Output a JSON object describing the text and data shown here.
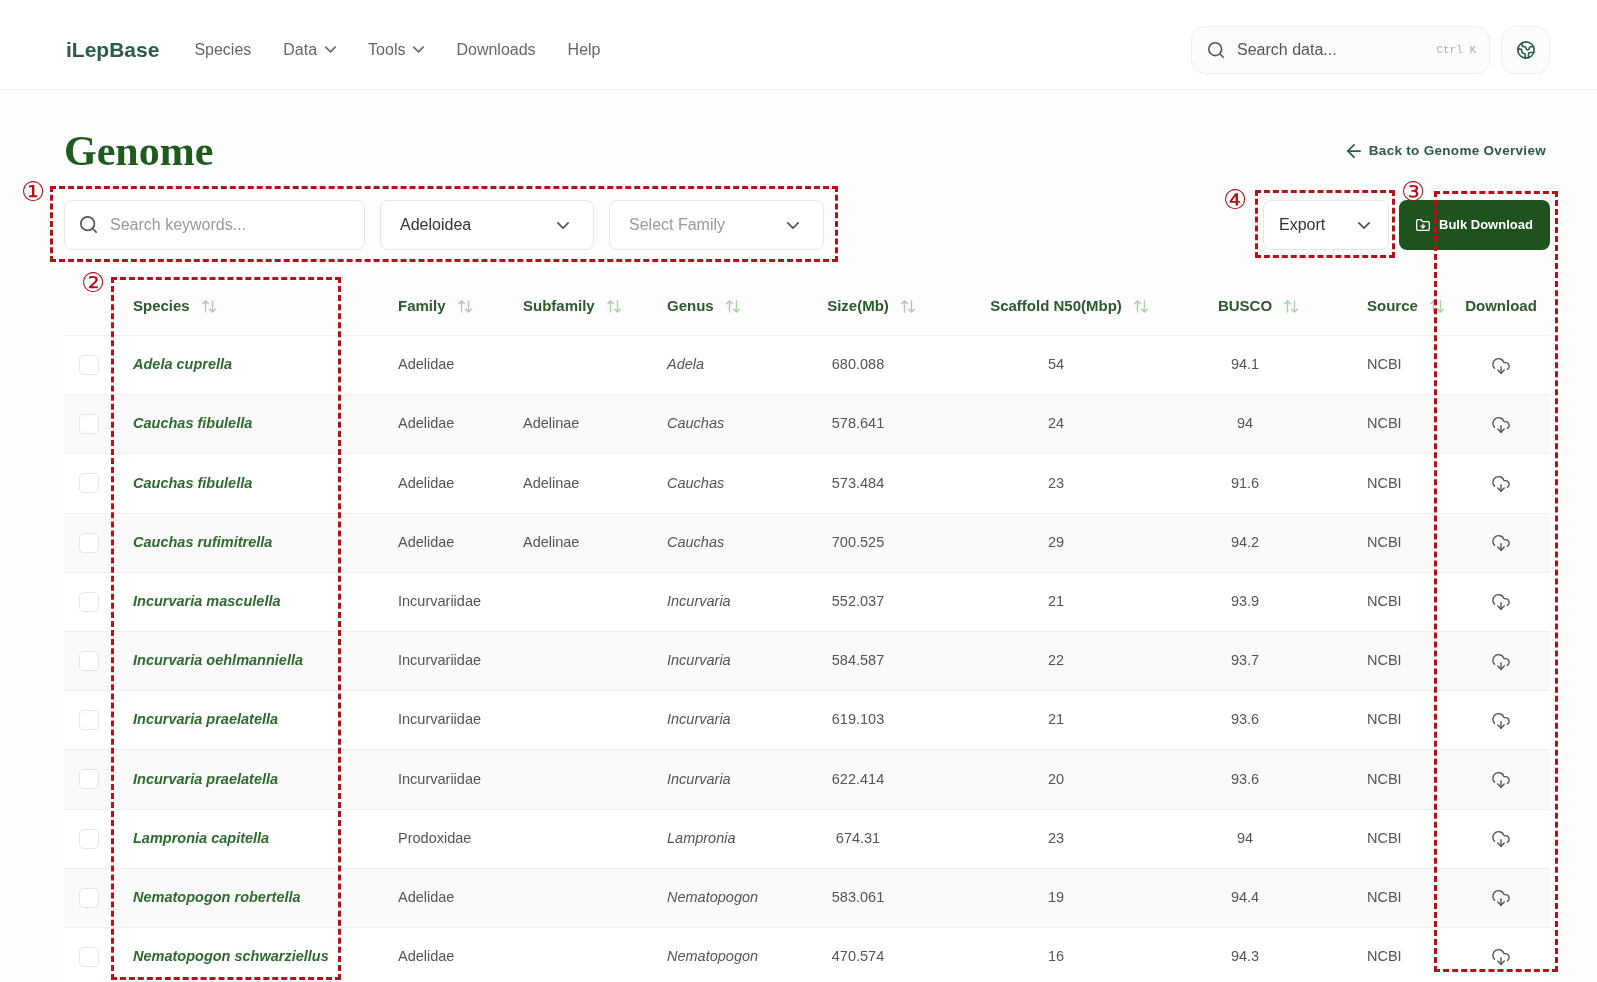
{
  "header": {
    "logo": "iLepBase",
    "nav": [
      {
        "label": "Species",
        "menu": false
      },
      {
        "label": "Data",
        "menu": true
      },
      {
        "label": "Tools",
        "menu": true
      },
      {
        "label": "Downloads",
        "menu": false
      },
      {
        "label": "Help",
        "menu": false
      }
    ],
    "search": {
      "placeholder": "Search data...",
      "shortcut": "Ctrl K"
    }
  },
  "page": {
    "title": "Genome",
    "back_link": "Back to Genome Overview"
  },
  "filters": {
    "keyword_search": {
      "placeholder": "Search keywords..."
    },
    "superfamily_select": {
      "value": "Adeloidea"
    },
    "family_select": {
      "placeholder": "Select Family"
    }
  },
  "actions": {
    "export_menu": {
      "label": "Export"
    },
    "bulk_download": {
      "label": "Bulk Download"
    }
  },
  "table": {
    "columns": [
      {
        "label": "Species",
        "sortable": true
      },
      {
        "label": "Family",
        "sortable": true
      },
      {
        "label": "Subfamily",
        "sortable": true
      },
      {
        "label": "Genus",
        "sortable": true
      },
      {
        "label": "Size(Mb)",
        "sortable": true
      },
      {
        "label": "Scaffold N50(Mbp)",
        "sortable": true
      },
      {
        "label": "BUSCO",
        "sortable": true
      },
      {
        "label": "Source",
        "sortable": true
      },
      {
        "label": "Download",
        "sortable": false
      }
    ],
    "rows": [
      {
        "checked": false,
        "species": "Adela cuprella",
        "family": "Adelidae",
        "genus": "Adela",
        "size_mb": "680.088",
        "scaffold_n50_mbp": "54",
        "busco": "94.1",
        "source": "NCBI"
      },
      {
        "checked": false,
        "species": "Cauchas fibulella",
        "family": "Adelidae",
        "subfamily": "Adelinae",
        "genus": "Cauchas",
        "size_mb": "578.641",
        "scaffold_n50_mbp": "24",
        "busco": "94",
        "source": "NCBI"
      },
      {
        "checked": false,
        "species": "Cauchas fibulella",
        "family": "Adelidae",
        "subfamily": "Adelinae",
        "genus": "Cauchas",
        "size_mb": "573.484",
        "scaffold_n50_mbp": "23",
        "busco": "91.6",
        "source": "NCBI"
      },
      {
        "checked": false,
        "species": "Cauchas rufimitrella",
        "family": "Adelidae",
        "subfamily": "Adelinae",
        "genus": "Cauchas",
        "size_mb": "700.525",
        "scaffold_n50_mbp": "29",
        "busco": "94.2",
        "source": "NCBI"
      },
      {
        "checked": false,
        "species": "Incurvaria masculella",
        "family": "Incurvariidae",
        "genus": "Incurvaria",
        "size_mb": "552.037",
        "scaffold_n50_mbp": "21",
        "busco": "93.9",
        "source": "NCBI"
      },
      {
        "checked": false,
        "species": "Incurvaria oehlmanniella",
        "family": "Incurvariidae",
        "genus": "Incurvaria",
        "size_mb": "584.587",
        "scaffold_n50_mbp": "22",
        "busco": "93.7",
        "source": "NCBI"
      },
      {
        "checked": false,
        "species": "Incurvaria praelatella",
        "family": "Incurvariidae",
        "genus": "Incurvaria",
        "size_mb": "619.103",
        "scaffold_n50_mbp": "21",
        "busco": "93.6",
        "source": "NCBI"
      },
      {
        "checked": false,
        "species": "Incurvaria praelatella",
        "family": "Incurvariidae",
        "genus": "Incurvaria",
        "size_mb": "622.414",
        "scaffold_n50_mbp": "20",
        "busco": "93.6",
        "source": "NCBI"
      },
      {
        "checked": false,
        "species": "Lampronia capitella",
        "family": "Prodoxidae",
        "genus": "Lampronia",
        "size_mb": "674.31",
        "scaffold_n50_mbp": "23",
        "busco": "94",
        "source": "NCBI"
      },
      {
        "checked": false,
        "species": "Nematopogon robertella",
        "family": "Adelidae",
        "genus": "Nematopogon",
        "size_mb": "583.061",
        "scaffold_n50_mbp": "19",
        "busco": "94.4",
        "source": "NCBI"
      },
      {
        "checked": false,
        "species": "Nematopogon schwarziellus",
        "family": "Adelidae",
        "genus": "Nematopogon",
        "size_mb": "470.574",
        "scaffold_n50_mbp": "16",
        "busco": "94.3",
        "source": "NCBI"
      }
    ]
  },
  "annotations": [
    {
      "number": "①",
      "kind": "filterbar"
    },
    {
      "number": "②",
      "kind": "speciescolumn"
    },
    {
      "number": "③",
      "kind": "downloadcolumn"
    },
    {
      "number": "④",
      "kind": "exportmenu"
    }
  ]
}
